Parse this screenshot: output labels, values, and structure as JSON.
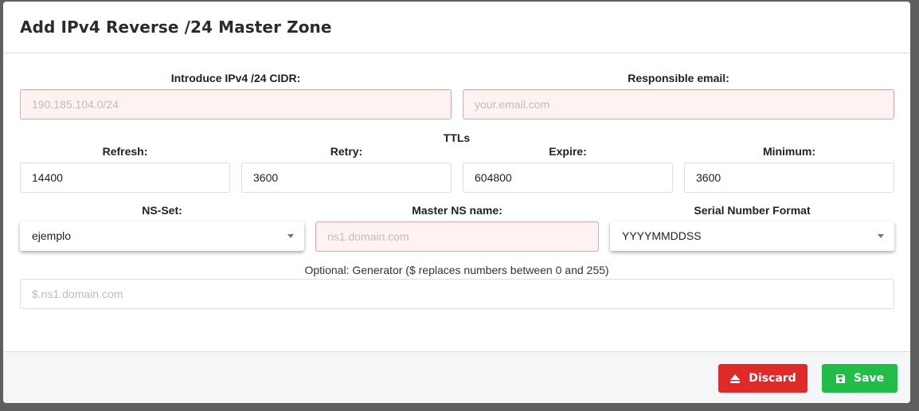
{
  "modal": {
    "title": "Add IPv4 Reverse /24 Master Zone"
  },
  "cidr": {
    "label": "Introduce IPv4 /24 CIDR:",
    "placeholder": "190.185.104.0/24",
    "value": ""
  },
  "email": {
    "label": "Responsible email:",
    "placeholder": "your.email.com",
    "value": ""
  },
  "ttls": {
    "heading": "TTLs",
    "refresh": {
      "label": "Refresh:",
      "value": "14400"
    },
    "retry": {
      "label": "Retry:",
      "value": "3600"
    },
    "expire": {
      "label": "Expire:",
      "value": "604800"
    },
    "minimum": {
      "label": "Minimum:",
      "value": "3600"
    }
  },
  "nsset": {
    "label": "NS-Set:",
    "selected": "ejemplo"
  },
  "master_ns": {
    "label": "Master NS name:",
    "placeholder": "ns1.domain.com",
    "value": ""
  },
  "serial": {
    "label": "Serial Number Format",
    "selected": "YYYYMMDDSS"
  },
  "generator": {
    "label": "Optional: Generator ($ replaces numbers between 0 and 255)",
    "placeholder": "$.ns1.domain.com",
    "value": ""
  },
  "footer": {
    "discard_label": "Discard",
    "save_label": "Save"
  },
  "colors": {
    "discard": "#e02a2a",
    "save": "#22bd48",
    "error_border": "#e6a4a4",
    "error_bg": "#fff2f2"
  },
  "icons": {
    "discard": "eject-icon",
    "save": "floppy-disk-icon",
    "select_caret": "caret-down-icon"
  }
}
